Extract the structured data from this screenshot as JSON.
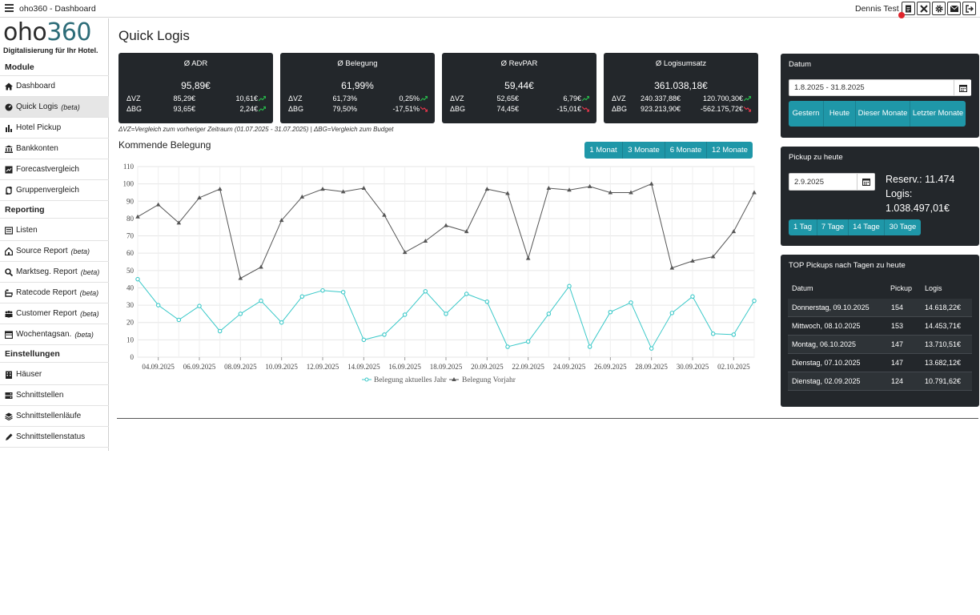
{
  "window": {
    "title": "oho360 - Dashboard",
    "user": "Dennis Test"
  },
  "logo": {
    "brand_dark": "oho",
    "brand_teal": "360",
    "tagline": "Digitalisierung für Ihr Hotel."
  },
  "sidebar": {
    "sections": [
      {
        "label": "Module"
      },
      {
        "label": "Reporting"
      },
      {
        "label": "Einstellungen"
      }
    ],
    "items": [
      {
        "label": "Dashboard",
        "icon": "home-icon"
      },
      {
        "label": "Quick Logis",
        "beta": "(beta)",
        "icon": "dashboard-icon",
        "active": true
      },
      {
        "label": "Hotel Pickup",
        "icon": "bar-chart-icon"
      },
      {
        "label": "Bankkonten",
        "icon": "bank-icon"
      },
      {
        "label": "Forecastvergleich",
        "icon": "forecast-icon"
      },
      {
        "label": "Gruppenvergleich",
        "icon": "group-icon"
      },
      {
        "label": "Listen",
        "icon": "list-icon"
      },
      {
        "label": "Source Report",
        "beta": "(beta)",
        "icon": "source-icon"
      },
      {
        "label": "Marktseg. Report",
        "beta": "(beta)",
        "icon": "search-icon"
      },
      {
        "label": "Ratecode Report",
        "beta": "(beta)",
        "icon": "ratecode-icon"
      },
      {
        "label": "Customer Report",
        "beta": "(beta)",
        "icon": "customers-icon"
      },
      {
        "label": "Wochentagsan.",
        "beta": "(beta)",
        "icon": "week-icon"
      },
      {
        "label": "Häuser",
        "icon": "building-icon"
      },
      {
        "label": "Schnittstellen",
        "icon": "server-icon"
      },
      {
        "label": "Schnittstellenläufe",
        "icon": "layers-icon"
      },
      {
        "label": "Schnittstellenstatus",
        "icon": "pen-icon"
      }
    ]
  },
  "page": {
    "title": "Quick Logis",
    "note": "ΔVZ=Vergleich zum vorheriger Zeitraum (01.07.2025 - 31.07.2025) | ΔBG=Vergleich zum Budget",
    "upcoming_title": "Kommende Belegung"
  },
  "kpis": [
    {
      "title": "Ø ADR",
      "value": "95,89€",
      "rows": [
        {
          "label": "ΔVZ",
          "mid": "85,29€",
          "delta": "10,61€",
          "trend": "up"
        },
        {
          "label": "ΔBG",
          "mid": "93,65€",
          "delta": "2,24€",
          "trend": "up"
        }
      ]
    },
    {
      "title": "Ø Belegung",
      "value": "61,99%",
      "rows": [
        {
          "label": "ΔVZ",
          "mid": "61,73%",
          "delta": "0,25%",
          "trend": "up"
        },
        {
          "label": "ΔBG",
          "mid": "79,50%",
          "delta": "-17,51%",
          "trend": "down"
        }
      ]
    },
    {
      "title": "Ø RevPAR",
      "value": "59,44€",
      "rows": [
        {
          "label": "ΔVZ",
          "mid": "52,65€",
          "delta": "6,79€",
          "trend": "up"
        },
        {
          "label": "ΔBG",
          "mid": "74,45€",
          "delta": "-15,01€",
          "trend": "down"
        }
      ]
    },
    {
      "title": "Ø Logisumsatz",
      "value": "361.038,18€",
      "rows": [
        {
          "label": "ΔVZ",
          "mid": "240.337,88€",
          "delta": "120.700,30€",
          "trend": "up"
        },
        {
          "label": "ΔBG",
          "mid": "923.213,90€",
          "delta": "-562.175,72€",
          "trend": "down"
        }
      ]
    }
  ],
  "range_buttons": [
    "1 Monat",
    "3 Monate",
    "6 Monate",
    "12 Monate"
  ],
  "datum_panel": {
    "title": "Datum",
    "range": "1.8.2025 - 31.8.2025",
    "buttons": [
      "Gestern",
      "Heute",
      "Dieser Monate",
      "Letzter Monate"
    ]
  },
  "pickup_panel": {
    "title": "Pickup zu heute",
    "date": "2.9.2025",
    "reserv": "Reserv.: 11.474",
    "logis_label": "Logis:",
    "logis_value": "1.038.497,01€",
    "buttons": [
      "1 Tag",
      "7 Tage",
      "14 Tage",
      "30 Tage"
    ]
  },
  "top_pickups": {
    "title": "TOP Pickups nach Tagen zu heute",
    "headers": [
      "Datum",
      "Pickup",
      "Logis"
    ],
    "rows": [
      [
        "Donnerstag, 09.10.2025",
        "154",
        "14.618,22€"
      ],
      [
        "Mittwoch, 08.10.2025",
        "153",
        "14.453,71€"
      ],
      [
        "Montag, 06.10.2025",
        "147",
        "13.710,51€"
      ],
      [
        "Dienstag, 07.10.2025",
        "147",
        "13.682,12€"
      ],
      [
        "Dienstag, 02.09.2025",
        "124",
        "10.791,62€"
      ]
    ]
  },
  "colors": {
    "teal": "#1f97a8",
    "dark": "#23272b",
    "current_series": "#3cc9c9",
    "previous_series": "#555555"
  },
  "chart_data": {
    "type": "line",
    "title": "",
    "xlabel": "",
    "ylabel": "",
    "ylim": [
      0,
      110
    ],
    "yticks": [
      0,
      10,
      20,
      30,
      40,
      50,
      60,
      70,
      80,
      90,
      100,
      110
    ],
    "grid": true,
    "legend": "bottom",
    "x": [
      "03.09.2025",
      "04.09.2025",
      "05.09.2025",
      "06.09.2025",
      "07.09.2025",
      "08.09.2025",
      "09.09.2025",
      "10.09.2025",
      "11.09.2025",
      "12.09.2025",
      "13.09.2025",
      "14.09.2025",
      "15.09.2025",
      "16.09.2025",
      "17.09.2025",
      "18.09.2025",
      "19.09.2025",
      "20.09.2025",
      "21.09.2025",
      "22.09.2025",
      "23.09.2025",
      "24.09.2025",
      "25.09.2025",
      "26.09.2025",
      "27.09.2025",
      "28.09.2025",
      "29.09.2025",
      "30.09.2025",
      "01.10.2025",
      "02.10.2025",
      "03.10.2025"
    ],
    "xtick_labels": [
      "04.09.2025",
      "06.09.2025",
      "08.09.2025",
      "10.09.2025",
      "12.09.2025",
      "14.09.2025",
      "16.09.2025",
      "18.09.2025",
      "20.09.2025",
      "22.09.2025",
      "24.09.2025",
      "26.09.2025",
      "28.09.2025",
      "30.09.2025",
      "02.10.2025"
    ],
    "series": [
      {
        "name": "Belegung aktuelles Jahr",
        "marker": "circle",
        "values": [
          45,
          30,
          21.5,
          29.5,
          15,
          25,
          32.5,
          20,
          35,
          38.5,
          37.5,
          10,
          13,
          24.5,
          38,
          25,
          36.5,
          32,
          6,
          9,
          25,
          41,
          6,
          26,
          31.5,
          5,
          25.5,
          35,
          13.5,
          13,
          32.5
        ]
      },
      {
        "name": "Belegung Vorjahr",
        "marker": "triangle",
        "values": [
          81,
          88,
          77.5,
          92,
          97,
          45.5,
          52,
          79,
          92.5,
          97,
          95.5,
          97.5,
          82,
          60.5,
          67,
          76,
          72.5,
          97,
          94.5,
          57,
          97.5,
          96.5,
          98.5,
          95,
          95,
          100,
          51.5,
          55.5,
          58,
          72.5,
          95
        ]
      }
    ]
  }
}
